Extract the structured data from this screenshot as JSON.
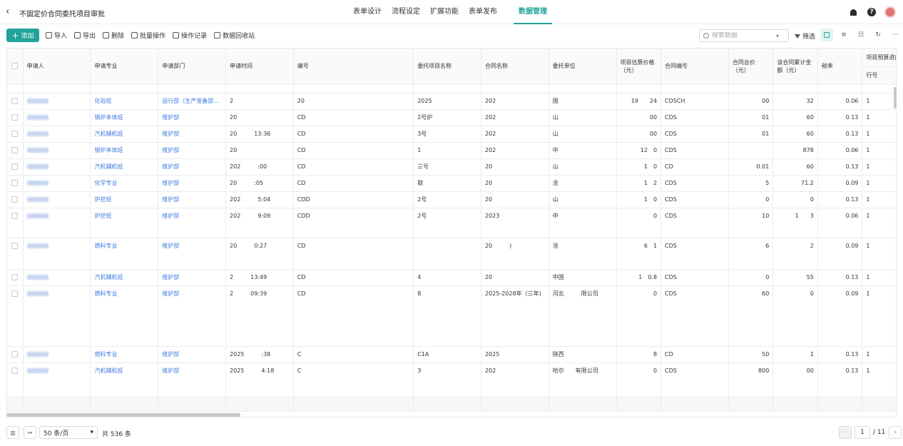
{
  "header": {
    "back_icon": "chevron-left-icon",
    "title": "不固定价合同委托项目审批",
    "tabs": [
      {
        "label": "表单设计"
      },
      {
        "label": "流程设定"
      },
      {
        "label": "扩展功能"
      },
      {
        "label": "表单发布"
      },
      {
        "label": "数据管理",
        "active": true
      }
    ],
    "icons": [
      "bell-icon",
      "help-icon",
      "avatar"
    ]
  },
  "toolbar": {
    "add_label": "添加",
    "actions": [
      {
        "label": "导入",
        "icon": "import-icon"
      },
      {
        "label": "导出",
        "icon": "export-icon"
      },
      {
        "label": "删除",
        "icon": "trash-icon"
      },
      {
        "label": "批量操作",
        "icon": "batch-icon"
      },
      {
        "label": "操作记录",
        "icon": "history-icon"
      },
      {
        "label": "数据回收站",
        "icon": "recycle-icon"
      }
    ],
    "search_placeholder": "搜索数据",
    "filter_label": "筛选"
  },
  "table": {
    "columns": [
      "申请人",
      "申请专业",
      "申请部门",
      "申请时间",
      "编号",
      "委托项目名称",
      "合同名称",
      "委托单位",
      "项目估算价格（元）",
      "合同编号",
      "合同总价（元）",
      "该合同累计金额（元）",
      "税率",
      "项目预算进度"
    ],
    "sub_column": "行号",
    "rows": [
      {
        "major": "化验班",
        "dept": "运行部（生产准备部...",
        "time": "2",
        "code": "20",
        "project": "2025",
        "contract": "202",
        "unit": "国",
        "est": "19　　24",
        "cno": "CDSCH",
        "total": "00",
        "cum": "32",
        "tax": "0.06",
        "line": "1"
      },
      {
        "major": "锅炉本体班",
        "dept": "维护部",
        "time": "20",
        "code": "CD",
        "project": "2号炉",
        "contract": "202",
        "unit": "山",
        "est": "00",
        "cno": "CDS",
        "total": "01",
        "cum": "60",
        "tax": "0.13",
        "line": "1"
      },
      {
        "major": "汽机辅机班",
        "dept": "维护部",
        "time": "20　　　13:36",
        "code": "CD",
        "project": "3号",
        "contract": "202",
        "unit": "山",
        "est": "00",
        "cno": "CDS",
        "total": "01",
        "cum": "60",
        "tax": "0.13",
        "line": "1"
      },
      {
        "major": "锅炉本体班",
        "dept": "维护部",
        "time": "20",
        "code": "CD",
        "project": "1",
        "contract": "202",
        "unit": "中",
        "est": "12　0",
        "cno": "CDS",
        "total": "",
        "cum": "878",
        "tax": "0.06",
        "line": "1"
      },
      {
        "major": "汽机辅机班",
        "dept": "维护部",
        "time": "202　　　:00",
        "code": "CD",
        "project": "三号",
        "contract": "20",
        "unit": "山",
        "est": "1　0",
        "cno": "CD",
        "total": "0.01",
        "cum": "60",
        "tax": "0.13",
        "line": "1"
      },
      {
        "major": "化学专业",
        "dept": "维护部",
        "time": "20　　　:05",
        "code": "CD",
        "project": "取",
        "contract": "20",
        "unit": "沧",
        "est": "1　2",
        "cno": "CDS",
        "total": "5",
        "cum": "71.2",
        "tax": "0.09",
        "line": "1"
      },
      {
        "major": "炉控班",
        "dept": "维护部",
        "time": "202　　　5:04",
        "code": "CDD",
        "project": "2号",
        "contract": "20",
        "unit": "山",
        "est": "1　0",
        "cno": "CDS",
        "total": "0",
        "cum": "0",
        "tax": "0.13",
        "line": "1"
      },
      {
        "major": "炉控班",
        "dept": "维护部",
        "time": "202　　　9:09",
        "code": "CDD",
        "project": "2号",
        "contract": "2023",
        "unit": "中",
        "est": "0",
        "cno": "CDS",
        "total": "10",
        "cum": "1　　3",
        "tax": "0.06",
        "line": "1",
        "tall": 42
      },
      {
        "major": "燃料专业",
        "dept": "维护部",
        "time": "20　　　0:27",
        "code": "CD",
        "project": "",
        "contract": "20　　　)",
        "unit": "沧",
        "est": "6　1",
        "cno": "CDS",
        "total": "6",
        "cum": "2",
        "tax": "0.09",
        "line": "1",
        "tall": 44
      },
      {
        "major": "汽机辅机班",
        "dept": "维护部",
        "time": "2　　　13:49",
        "code": "CD",
        "project": "4",
        "contract": "20",
        "unit": "中国",
        "est": "1　0.8",
        "cno": "CDS",
        "total": "0",
        "cum": "55",
        "tax": "0.13",
        "line": "1"
      },
      {
        "major": "燃料专业",
        "dept": "维护部",
        "time": "2　　　09:39",
        "code": "CD",
        "project": "8",
        "contract": "2025-2028年（三年)",
        "unit": "河北　　　限公司",
        "est": "0",
        "cno": "CDS",
        "total": "60",
        "cum": "0",
        "tax": "0.09",
        "line": "1",
        "tall": 85
      },
      {
        "major": "燃料专业",
        "dept": "维护部",
        "time": "2025　　　:38",
        "code": "C",
        "project": "C1A",
        "contract": "2025",
        "unit": "陕西",
        "est": "8",
        "cno": "CD",
        "total": "50",
        "cum": "1",
        "tax": "0.13",
        "line": "1"
      },
      {
        "major": "汽机辅机班",
        "dept": "维护部",
        "time": "2025　　　4:18",
        "code": "C",
        "project": "3",
        "contract": "202",
        "unit": "哈尔　　有限公司",
        "est": "0",
        "cno": "CDS",
        "total": "800",
        "cum": "00",
        "tax": "0.13",
        "line": "1",
        "tall": 48
      }
    ]
  },
  "footer": {
    "page_size": "50 条/页",
    "total": "共 536 条",
    "current_page": "1",
    "total_pages": "/ 11"
  },
  "colors": {
    "accent": "#20a39a",
    "link": "#3a7be0"
  }
}
